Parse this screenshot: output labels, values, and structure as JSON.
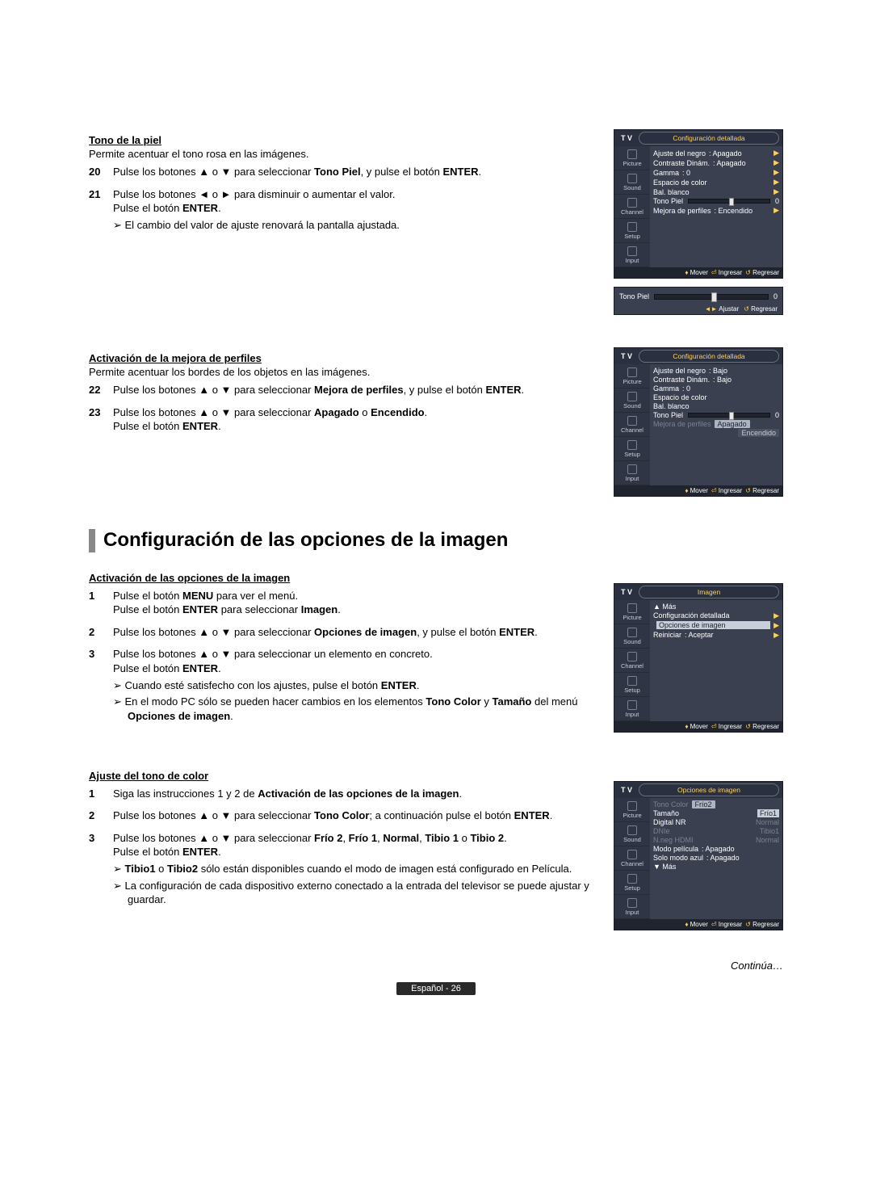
{
  "section1": {
    "title": "Tono de la piel",
    "lead": "Permite acentuar el tono rosa en las imágenes.",
    "steps": [
      {
        "num": "20",
        "text_a": "Pulse los botones ▲ o ▼ para seleccionar ",
        "text_b": "Tono Piel",
        "text_c": ", y pulse el botón ",
        "text_d": "ENTER",
        "text_e": "."
      },
      {
        "num": "21",
        "text_a": "Pulse los botones ◄ o ► para disminuir o aumentar el valor.",
        "line2_a": "Pulse el botón ",
        "line2_b": "ENTER",
        "line2_c": ".",
        "note": "El cambio del valor de ajuste renovará la pantalla ajustada."
      }
    ]
  },
  "section2": {
    "title": "Activación de la mejora de perfiles",
    "lead": "Permite acentuar los bordes de los objetos en las imágenes.",
    "steps": [
      {
        "num": "22",
        "text_a": "Pulse los botones ▲ o ▼ para seleccionar ",
        "text_b": "Mejora de perfiles",
        "text_c": ", y pulse el botón ",
        "text_d": "ENTER",
        "text_e": "."
      },
      {
        "num": "23",
        "text_a": "Pulse los botones ▲ o ▼ para seleccionar ",
        "text_b": "Apagado",
        "text_c": " o ",
        "text_d": "Encendido",
        "text_e": ".",
        "line2_a": "Pulse el botón ",
        "line2_b": "ENTER",
        "line2_c": "."
      }
    ]
  },
  "bigtitle": "Configuración de las opciones de la imagen",
  "section3": {
    "title": "Activación de las opciones de la imagen",
    "steps": [
      {
        "num": "1",
        "l1a": "Pulse el botón ",
        "l1b": "MENU",
        "l1c": " para ver el menú.",
        "l2a": "Pulse el botón ",
        "l2b": "ENTER",
        "l2c": " para seleccionar ",
        "l2d": "Imagen",
        "l2e": "."
      },
      {
        "num": "2",
        "l1a": "Pulse los botones ▲ o ▼ para seleccionar ",
        "l1b": "Opciones de imagen",
        "l1c": ", y pulse el botón ",
        "l1d": "ENTER",
        "l1e": "."
      },
      {
        "num": "3",
        "l1": "Pulse los botones ▲ o ▼ para seleccionar un elemento en concreto.",
        "l2a": "Pulse el botón ",
        "l2b": "ENTER",
        "l2c": ".",
        "n1a": "Cuando esté satisfecho con los ajustes, pulse el botón ",
        "n1b": "ENTER",
        "n1c": ".",
        "n2a": "En el modo PC sólo se pueden hacer cambios en los elementos ",
        "n2b": "Tono Color",
        "n2c": " y ",
        "n2d": "Tamaño",
        "n2e": " del menú ",
        "n2f": "Opciones de imagen",
        "n2g": "."
      }
    ]
  },
  "section4": {
    "title": "Ajuste del tono de color",
    "steps": [
      {
        "num": "1",
        "l1a": "Siga las instrucciones 1 y 2 de ",
        "l1b": "Activación de las opciones de la imagen",
        "l1c": "."
      },
      {
        "num": "2",
        "l1a": "Pulse los botones ▲ o ▼ para seleccionar ",
        "l1b": "Tono Color",
        "l1c": "; a continuación pulse el botón ",
        "l1d": "ENTER",
        "l1e": "."
      },
      {
        "num": "3",
        "l1a": "Pulse los botones ▲ o ▼ para seleccionar ",
        "l1b": "Frío 2",
        "l1c": ", ",
        "l1d": "Frío 1",
        "l1e": ", ",
        "l1f": "Normal",
        "l1g": ", ",
        "l1h": "Tibio 1",
        "l1i": " o ",
        "l1j": "Tibio 2",
        "l1k": ".",
        "l2a": "Pulse el botón ",
        "l2b": "ENTER",
        "l2c": ".",
        "n1a": "Tibio1",
        "n1b": " o ",
        "n1c": "Tibio2",
        "n1d": " sólo están disponibles cuando el modo de imagen está configurado en Película.",
        "n2": "La configuración de cada dispositivo externo conectado a la entrada del televisor se puede ajustar y guardar."
      }
    ]
  },
  "continua": "Continúa…",
  "pagefoot": "Español - 26",
  "tv": {
    "label": "T V",
    "tabs": [
      "Picture",
      "Sound",
      "Channel",
      "Setup",
      "Input"
    ],
    "footer": {
      "mover": "Mover",
      "ingresar": "Ingresar",
      "regresar": "Regresar",
      "ajustar": "Ajustar"
    }
  },
  "menu1": {
    "title": "Configuración detallada",
    "items": [
      {
        "label": "Ajuste del negro",
        "val": ": Apagado",
        "arrow": true
      },
      {
        "label": "Contraste Dinám.",
        "val": ": Apagado",
        "arrow": true
      },
      {
        "label": "Gamma",
        "val": ": 0",
        "arrow": true
      },
      {
        "label": "Espacio de color",
        "arrow": true
      },
      {
        "label": "Bal. blanco",
        "arrow": true
      },
      {
        "label": "Tono Piel",
        "slider": true,
        "sval": "0"
      },
      {
        "label": "Mejora de perfiles",
        "val": ": Encendido",
        "arrow": true
      }
    ]
  },
  "mini": {
    "label": "Tono Piel",
    "val": "0"
  },
  "menu2": {
    "title": "Configuración detallada",
    "items": [
      {
        "label": "Ajuste del negro",
        "val": ": Bajo"
      },
      {
        "label": "Contraste Dinám.",
        "val": ": Bajo"
      },
      {
        "label": "Gamma",
        "val": ": 0"
      },
      {
        "label": "Espacio de color"
      },
      {
        "label": "Bal. blanco"
      },
      {
        "label": "Tono Piel",
        "slider": true,
        "sval": "0"
      },
      {
        "label": "Mejora de perfiles",
        "dim": true,
        "sel": "Apagado",
        "other": "Encendido"
      }
    ]
  },
  "menu3": {
    "title": "Imagen",
    "items": [
      {
        "label": "▲ Más"
      },
      {
        "label": "Configuración detallada",
        "arrow": true
      },
      {
        "label": "Opciones de imagen",
        "arrow": true,
        "hl": true
      },
      {
        "label": "Reiniciar",
        "val": ": Aceptar",
        "arrow": true
      }
    ]
  },
  "menu4": {
    "title": "Opciones de imagen",
    "items": [
      {
        "label": "Tono Color",
        "dim": true,
        "sel": "Frío2",
        "other": "Frío1"
      },
      {
        "label": "Tamaño",
        "dim": true,
        "sublabel": "Normal"
      },
      {
        "label": "Digital NR",
        "dim": true,
        "sublabel": "Frío1"
      },
      {
        "label": "DNIe",
        "dim": true,
        "sublabel": "Tibio1"
      },
      {
        "label": "N.neg HDMI",
        "dim": true,
        "sublabel": "Normal"
      },
      {
        "label": "Modo película",
        "val": ": Apagado"
      },
      {
        "label": "Solo modo azul",
        "val": ": Apagado"
      },
      {
        "label": "▼ Más"
      }
    ]
  }
}
